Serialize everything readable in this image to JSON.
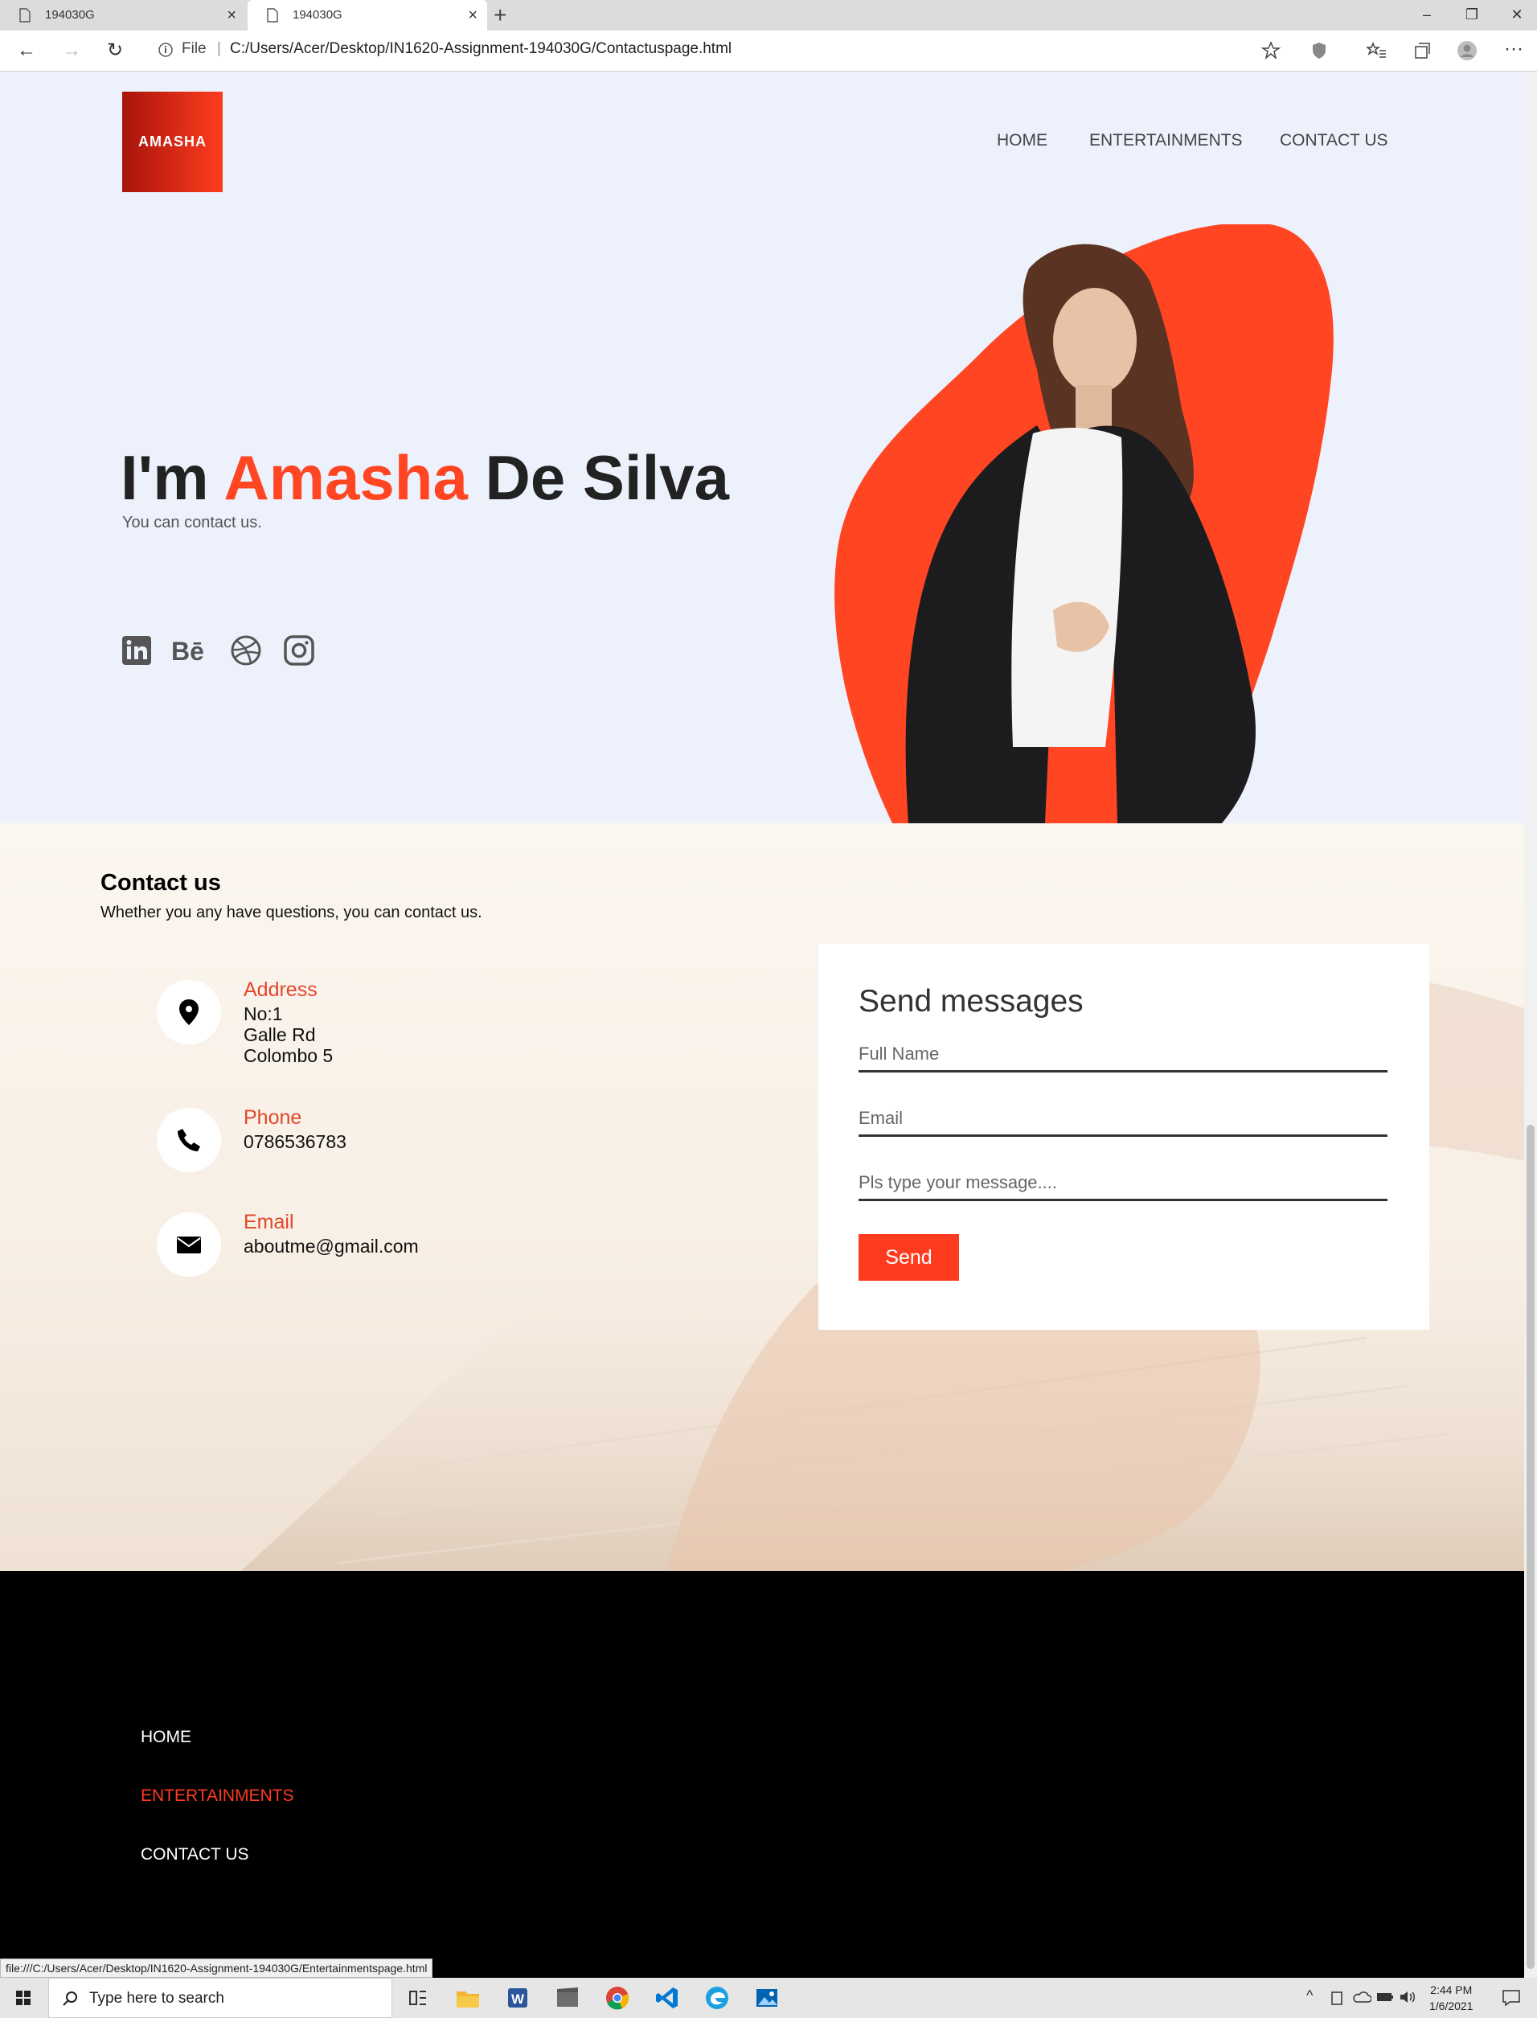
{
  "browser": {
    "tabs": [
      {
        "title": "194030G"
      },
      {
        "title": "194030G"
      }
    ],
    "url_scheme_label": "File",
    "url": "C:/Users/Acer/Desktop/IN1620-Assignment-194030G/Contactuspage.html",
    "status_url": "file:///C:/Users/Acer/Desktop/IN1620-Assignment-194030G/Entertainmentspage.html"
  },
  "header": {
    "logo_text": "AMASHA",
    "nav": [
      "HOME",
      "ENTERTAINMENTS",
      "CONTACT US"
    ]
  },
  "hero": {
    "title_prefix": "I'm ",
    "title_accent": "Amasha",
    "title_suffix": " De Silva",
    "subtitle": "You can contact us.",
    "socials": [
      "linkedin-icon",
      "behance-icon",
      "dribbble-icon",
      "instagram-icon"
    ]
  },
  "contact": {
    "title": "Contact us",
    "subtitle": "Whether you any have questions, you can contact us.",
    "address": {
      "label": "Address",
      "lines": [
        "No:1",
        "Galle Rd",
        "Colombo 5"
      ]
    },
    "phone": {
      "label": "Phone",
      "value": "0786536783"
    },
    "email": {
      "label": "Email",
      "value": "aboutme@gmail.com"
    },
    "form": {
      "title": "Send messages",
      "name_placeholder": "Full Name",
      "email_placeholder": "Email",
      "message_placeholder": "Pls type your message....",
      "send_label": "Send"
    }
  },
  "footer": {
    "links": [
      "HOME",
      "ENTERTAINMENTS",
      "CONTACT US"
    ]
  },
  "taskbar": {
    "search_placeholder": "Type here to search",
    "time": "2:44 PM",
    "date": "1/6/2021"
  },
  "colors": {
    "accent": "#ff4522",
    "hero_bg": "#edf1fc",
    "footer_bg": "#000000"
  }
}
